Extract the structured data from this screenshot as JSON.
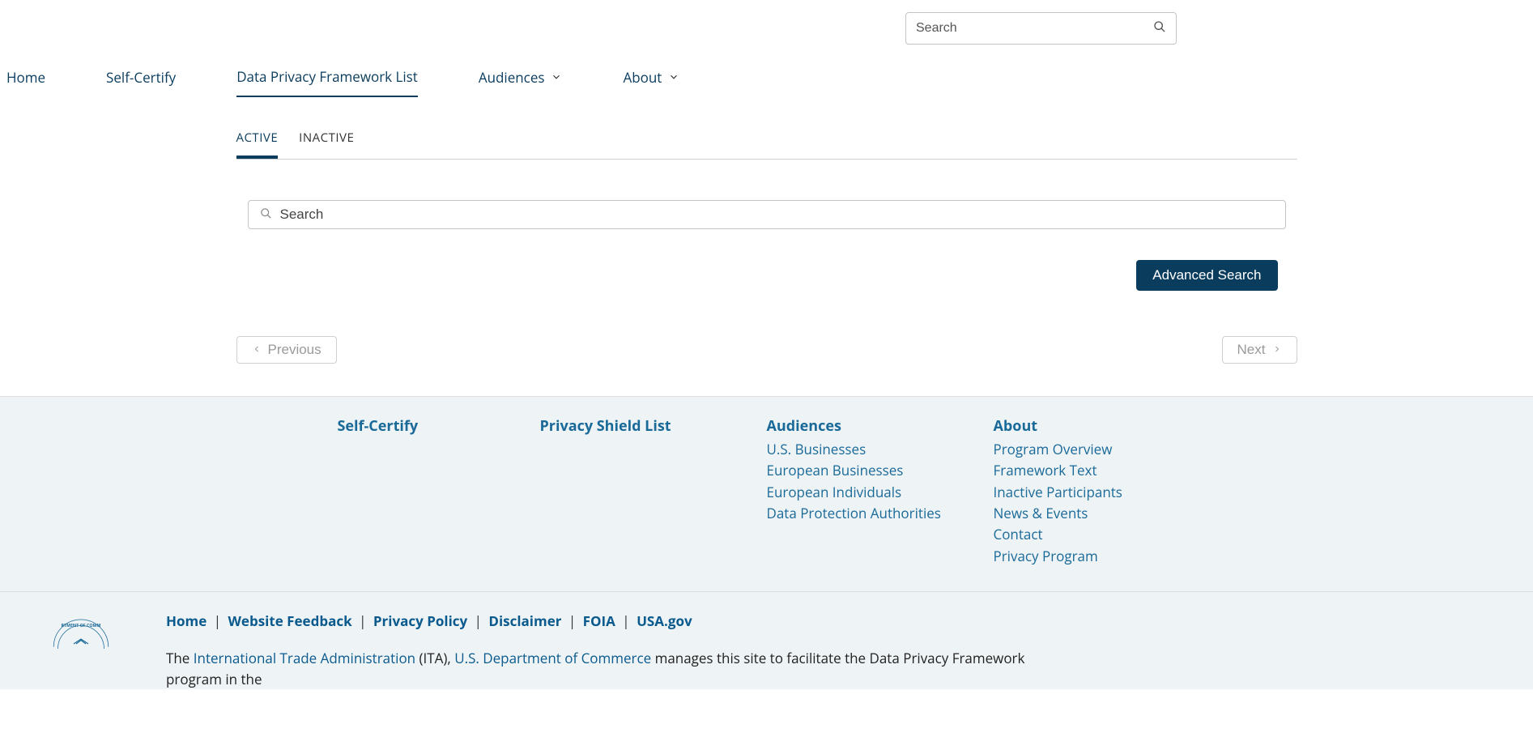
{
  "header": {
    "search_placeholder": "Search"
  },
  "nav": {
    "items": [
      {
        "label": "Home",
        "dropdown": false
      },
      {
        "label": "Self-Certify",
        "dropdown": false
      },
      {
        "label": "Data Privacy Framework List",
        "dropdown": false,
        "active": true
      },
      {
        "label": "Audiences",
        "dropdown": true
      },
      {
        "label": "About",
        "dropdown": true
      }
    ]
  },
  "tabs": {
    "items": [
      {
        "label": "ACTIVE",
        "active": true
      },
      {
        "label": "INACTIVE",
        "active": false
      }
    ]
  },
  "list_search": {
    "placeholder": "Search"
  },
  "buttons": {
    "advanced_search": "Advanced Search",
    "previous": "Previous",
    "next": "Next"
  },
  "footer": {
    "col1": {
      "title": "Self-Certify"
    },
    "col2": {
      "title": "Privacy Shield List"
    },
    "col3": {
      "title": "Audiences",
      "links": [
        "U.S. Businesses",
        "European Businesses",
        "European Individuals",
        "Data Protection Authorities"
      ]
    },
    "col4": {
      "title": "About",
      "links": [
        "Program Overview",
        "Framework Text",
        "Inactive Participants",
        "News & Events",
        "Contact",
        "Privacy Program"
      ]
    }
  },
  "bottom": {
    "links": [
      "Home",
      "Website Feedback",
      "Privacy Policy",
      "Disclaimer",
      "FOIA",
      "USA.gov"
    ],
    "para_prefix": "The ",
    "para_link1": "International Trade Administration",
    "para_mid1": " (ITA), ",
    "para_link2": "U.S. Department of Commerce",
    "para_suffix": " manages this site to facilitate the Data Privacy Framework program in the"
  }
}
